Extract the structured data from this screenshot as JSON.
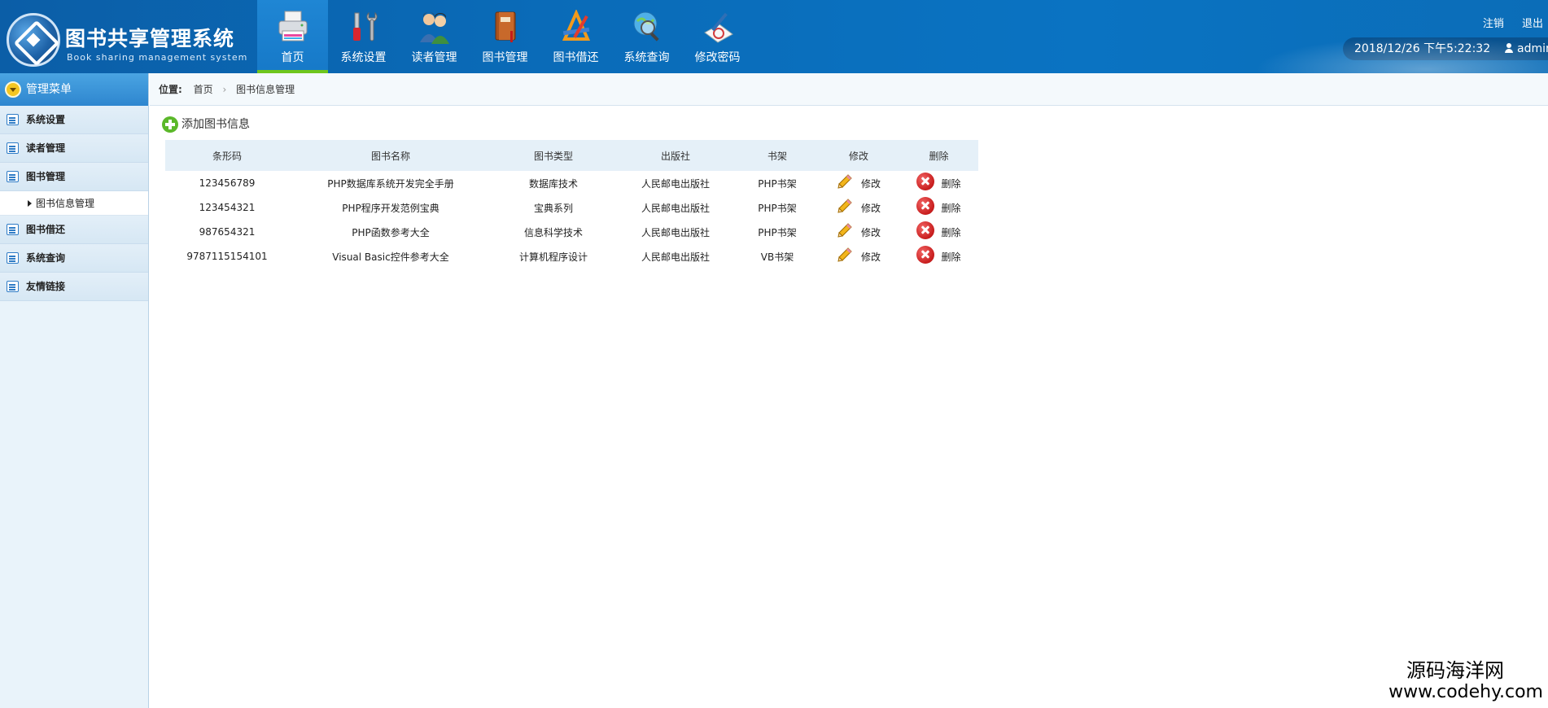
{
  "header": {
    "logo_title": "图书共享管理系统",
    "logo_subtitle": "Book sharing management system",
    "nav": [
      {
        "label": "首页",
        "icon": "printer-icon",
        "active": true
      },
      {
        "label": "系统设置",
        "icon": "tools-icon"
      },
      {
        "label": "读者管理",
        "icon": "users-icon"
      },
      {
        "label": "图书管理",
        "icon": "book-icon"
      },
      {
        "label": "图书借还",
        "icon": "drafting-icon"
      },
      {
        "label": "系统查询",
        "icon": "globe-search-icon"
      },
      {
        "label": "修改密码",
        "icon": "pen-paper-icon"
      }
    ],
    "logout_label": "注销",
    "exit_label": "退出",
    "datetime": "2018/12/26 下午5:22:32",
    "username": "admin"
  },
  "sidebar": {
    "title": "管理菜单",
    "items": [
      {
        "label": "系统设置"
      },
      {
        "label": "读者管理"
      },
      {
        "label": "图书管理",
        "sub": [
          {
            "label": "图书信息管理"
          }
        ]
      },
      {
        "label": "图书借还"
      },
      {
        "label": "系统查询"
      },
      {
        "label": "友情链接"
      }
    ]
  },
  "breadcrumb": {
    "prefix": "位置:",
    "items": [
      "首页",
      "图书信息管理"
    ]
  },
  "main": {
    "add_label": "添加图书信息",
    "table": {
      "headers": [
        "条形码",
        "图书名称",
        "图书类型",
        "出版社",
        "书架",
        "修改",
        "删除"
      ],
      "edit_label": "修改",
      "delete_label": "删除",
      "rows": [
        {
          "code": "123456789",
          "name": "PHP数据库系统开发完全手册",
          "type": "数据库技术",
          "publisher": "人民邮电出版社",
          "shelf": "PHP书架"
        },
        {
          "code": "123454321",
          "name": "PHP程序开发范例宝典",
          "type": "宝典系列",
          "publisher": "人民邮电出版社",
          "shelf": "PHP书架"
        },
        {
          "code": "987654321",
          "name": "PHP函数参考大全",
          "type": "信息科学技术",
          "publisher": "人民邮电出版社",
          "shelf": "PHP书架"
        },
        {
          "code": "9787115154101",
          "name": "Visual Basic控件参考大全",
          "type": "计算机程序设计",
          "publisher": "人民邮电出版社",
          "shelf": "VB书架"
        }
      ]
    }
  },
  "watermark": {
    "cn": "源码海洋网",
    "url": "www.codehy.com"
  },
  "colors": {
    "header_bg": "#0a6bb8",
    "active_underline": "#6ec61c",
    "sidebar_bg": "#e9f3fa",
    "table_header_bg": "#e5f0f8"
  }
}
